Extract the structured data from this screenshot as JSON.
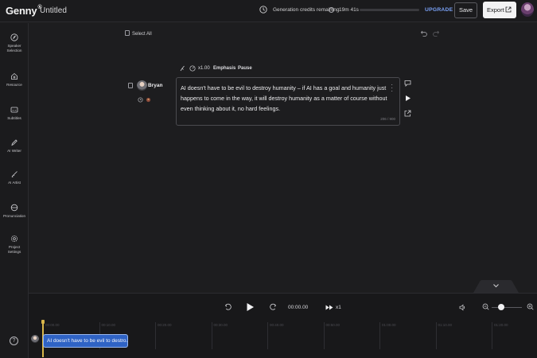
{
  "topbar": {
    "logo": "Genny",
    "logo_mark": "®",
    "project_title": "Untitled",
    "credits_label": "Generation credits remaining",
    "credits_info": "?",
    "credits_time": "19m 41s",
    "credits_fraction": 0.0,
    "upgrade_label": "UPGRADE",
    "save_label": "Save",
    "export_label": "Export"
  },
  "sidebar": {
    "items": [
      {
        "label1": "Speaker",
        "label2": "Selection",
        "icon": "speaker-selection-icon"
      },
      {
        "label1": "Resource",
        "label2": "",
        "icon": "resource-icon"
      },
      {
        "label1": "Subtitles",
        "label2": "",
        "icon": "subtitles-icon"
      },
      {
        "label1": "AI Writer",
        "label2": "",
        "icon": "ai-writer-icon"
      },
      {
        "label1": "AI Artist",
        "label2": "",
        "icon": "ai-artist-icon"
      },
      {
        "label1": "Pronunciation",
        "label2": "",
        "icon": "pronunciation-icon"
      },
      {
        "label1": "Project",
        "label2": "Settings",
        "icon": "gear-icon"
      }
    ],
    "help": "?"
  },
  "editor": {
    "select_all": "Select All",
    "toolbar": {
      "speed": "x1.00",
      "emphasis": "Emphasis",
      "pause": "Pause"
    },
    "block": {
      "speaker": "Bryan",
      "text": "AI doesn't have to be evil to destroy humanity – if AI has a goal and humanity just happens to come in the way, it will destroy humanity as a matter of course without even thinking about it, no hard feelings.",
      "counter": "206 / 900"
    }
  },
  "player": {
    "timecode": "00:00.00",
    "speed": "x1",
    "zoom_level": 0.2
  },
  "timeline": {
    "ticks": [
      "00:00.00",
      "00:10.00",
      "00:20.00",
      "00:30.00",
      "00:40.00",
      "00:50.00",
      "01:00.00",
      "01:10.00",
      "01:20.00"
    ],
    "clip_text": "AI doesn't have to be evil to destro..."
  },
  "colors": {
    "accent": "#2f63c5",
    "upgrade": "#7aa2f7",
    "playhead": "#d9b64a"
  }
}
